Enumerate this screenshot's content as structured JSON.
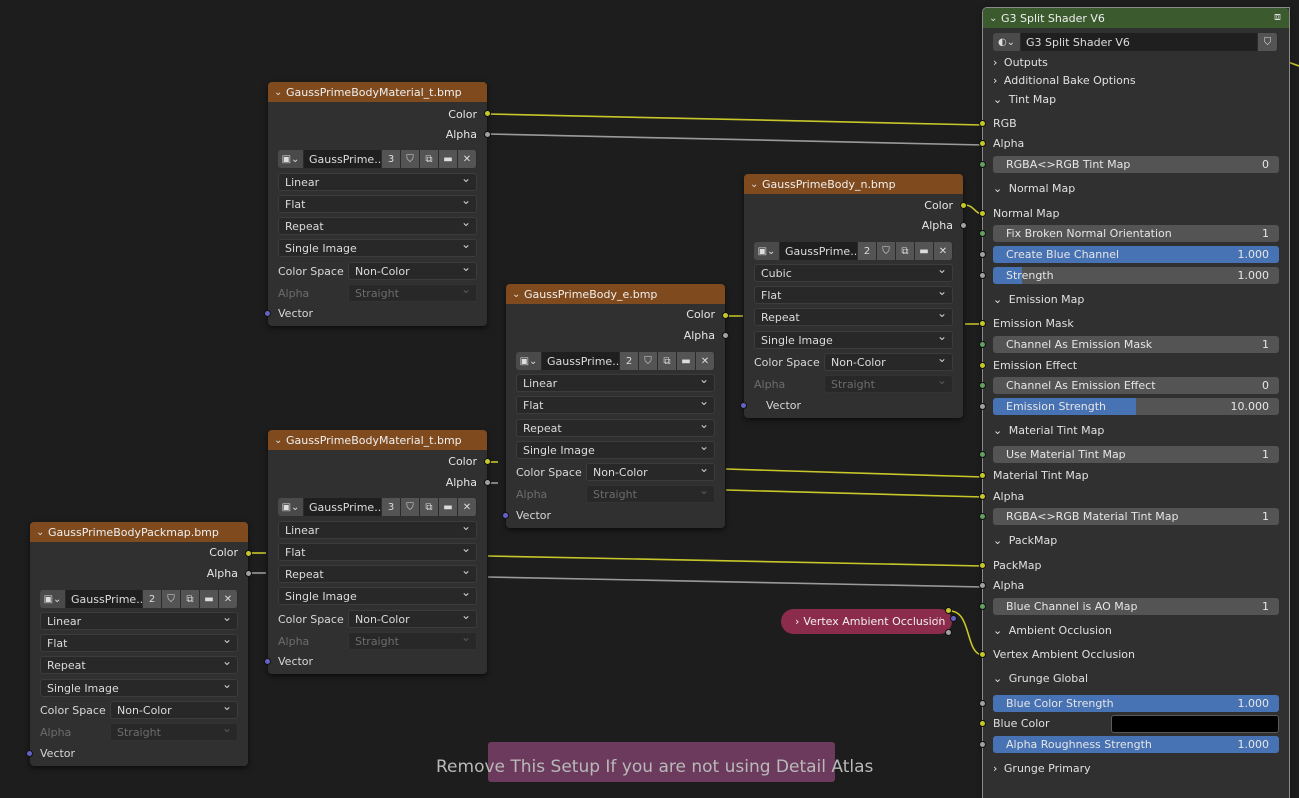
{
  "frame": {
    "label": "Remove This Setup If you are not using Detail Atlas"
  },
  "reroute": {
    "label": "Vertex Ambient Occlusion"
  },
  "image_nodes": [
    {
      "title": "GaussPrimeBodyMaterial_t.bmp",
      "outputs": [
        "Color",
        "Alpha"
      ],
      "image_name": "GaussPrime...",
      "users": "3",
      "interpolation": "Linear",
      "projection": "Flat",
      "extension": "Repeat",
      "source": "Single Image",
      "color_space_label": "Color Space",
      "color_space": "Non-Color",
      "alpha_label": "Alpha",
      "alpha_mode": "Straight",
      "vector": "Vector"
    },
    {
      "title": "GaussPrimeBody_n.bmp",
      "outputs": [
        "Color",
        "Alpha"
      ],
      "image_name": "GaussPrime...",
      "users": "2",
      "interpolation": "Cubic",
      "projection": "Flat",
      "extension": "Repeat",
      "source": "Single Image",
      "color_space_label": "Color Space",
      "color_space": "Non-Color",
      "alpha_label": "Alpha",
      "alpha_mode": "Straight",
      "vector": "Vector"
    },
    {
      "title": "GaussPrimeBody_e.bmp",
      "outputs": [
        "Color",
        "Alpha"
      ],
      "image_name": "GaussPrime...",
      "users": "2",
      "interpolation": "Linear",
      "projection": "Flat",
      "extension": "Repeat",
      "source": "Single Image",
      "color_space_label": "Color Space",
      "color_space": "Non-Color",
      "alpha_label": "Alpha",
      "alpha_mode": "Straight",
      "vector": "Vector"
    },
    {
      "title": "GaussPrimeBodyMaterial_t.bmp",
      "outputs": [
        "Color",
        "Alpha"
      ],
      "image_name": "GaussPrime...",
      "users": "3",
      "interpolation": "Linear",
      "projection": "Flat",
      "extension": "Repeat",
      "source": "Single Image",
      "color_space_label": "Color Space",
      "color_space": "Non-Color",
      "alpha_label": "Alpha",
      "alpha_mode": "Straight",
      "vector": "Vector"
    },
    {
      "title": "GaussPrimeBodyPackmap.bmp",
      "outputs": [
        "Color",
        "Alpha"
      ],
      "image_name": "GaussPrime...",
      "users": "2",
      "interpolation": "Linear",
      "projection": "Flat",
      "extension": "Repeat",
      "source": "Single Image",
      "color_space_label": "Color Space",
      "color_space": "Non-Color",
      "alpha_label": "Alpha",
      "alpha_mode": "Straight",
      "vector": "Vector"
    }
  ],
  "group_node": {
    "title": "G3 Split Shader V6",
    "group_name": "G3 Split Shader V6",
    "rows": [
      {
        "kind": "section",
        "label": "Outputs",
        "open": false
      },
      {
        "kind": "section",
        "label": "Additional Bake Options",
        "open": false
      },
      {
        "kind": "section",
        "label": "Tint Map",
        "open": true
      },
      {
        "kind": "input",
        "label": "RGB",
        "socket": "yellow"
      },
      {
        "kind": "input",
        "label": "Alpha",
        "socket": "yellow"
      },
      {
        "kind": "value",
        "label": "RGBA<>RGB Tint Map",
        "value": "0",
        "socket": "green"
      },
      {
        "kind": "section",
        "label": "Normal Map",
        "open": true
      },
      {
        "kind": "input",
        "label": "Normal Map",
        "socket": "yellow"
      },
      {
        "kind": "value",
        "label": "Fix Broken Normal Orientation",
        "value": "1",
        "socket": "green"
      },
      {
        "kind": "slider",
        "label": "Create Blue Channel",
        "value": "1.000",
        "fill": 1.0,
        "socket": "grey"
      },
      {
        "kind": "slider",
        "label": "Strength",
        "value": "1.000",
        "fill": 0.1,
        "socket": "grey"
      },
      {
        "kind": "section",
        "label": "Emission Map",
        "open": true
      },
      {
        "kind": "input",
        "label": "Emission Mask",
        "socket": "yellow"
      },
      {
        "kind": "value",
        "label": "Channel As Emission Mask",
        "value": "1",
        "socket": "green"
      },
      {
        "kind": "input",
        "label": "Emission Effect",
        "socket": "yellow"
      },
      {
        "kind": "value",
        "label": "Channel As Emission Effect",
        "value": "0",
        "socket": "green"
      },
      {
        "kind": "slider",
        "label": "Emission Strength",
        "value": "10.000",
        "fill": 0.5,
        "socket": "grey"
      },
      {
        "kind": "section",
        "label": "Material Tint Map",
        "open": true
      },
      {
        "kind": "value",
        "label": "Use Material Tint Map",
        "value": "1",
        "socket": "green"
      },
      {
        "kind": "input",
        "label": "Material Tint Map",
        "socket": "yellow"
      },
      {
        "kind": "input",
        "label": "Alpha",
        "socket": "yellow"
      },
      {
        "kind": "value",
        "label": "RGBA<>RGB Material Tint Map",
        "value": "1",
        "socket": "green"
      },
      {
        "kind": "section",
        "label": "PackMap",
        "open": true
      },
      {
        "kind": "input",
        "label": "PackMap",
        "socket": "yellow"
      },
      {
        "kind": "input",
        "label": "Alpha",
        "socket": "grey"
      },
      {
        "kind": "value",
        "label": "Blue Channel is AO Map",
        "value": "1",
        "socket": "green"
      },
      {
        "kind": "section",
        "label": "Ambient Occlusion",
        "open": true
      },
      {
        "kind": "input",
        "label": "Vertex Ambient Occlusion",
        "socket": "yellow"
      },
      {
        "kind": "section",
        "label": "Grunge Global",
        "open": true
      },
      {
        "kind": "slider",
        "label": "Blue Color Strength",
        "value": "1.000",
        "fill": 1.0,
        "socket": "grey"
      },
      {
        "kind": "color",
        "label": "Blue Color",
        "socket": "yellow"
      },
      {
        "kind": "slider",
        "label": "Alpha Roughness Strength",
        "value": "1.000",
        "fill": 1.0,
        "socket": "grey"
      },
      {
        "kind": "section",
        "label": "Grunge Primary",
        "open": false
      }
    ]
  }
}
